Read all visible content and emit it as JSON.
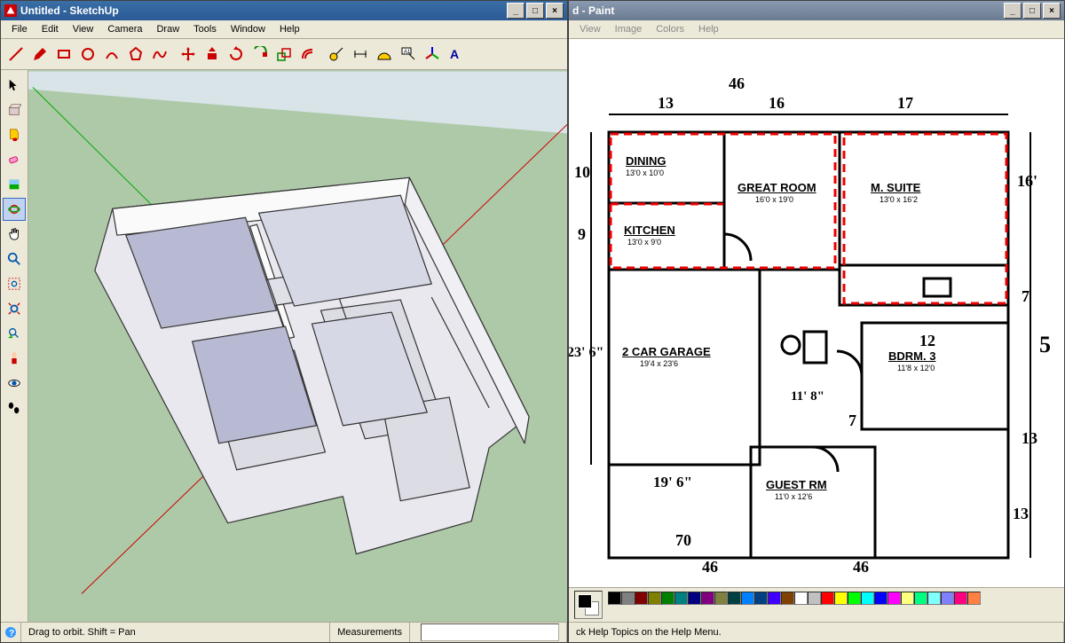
{
  "sketchup": {
    "title": "Untitled - SketchUp",
    "menus": [
      "File",
      "Edit",
      "View",
      "Camera",
      "Draw",
      "Tools",
      "Window",
      "Help"
    ],
    "status_hint": "Drag to orbit.  Shift = Pan",
    "measurements_label": "Measurements"
  },
  "paint": {
    "title": "d - Paint",
    "menus": [
      "View",
      "Image",
      "Colors",
      "Help"
    ],
    "status_hint": "ck Help Topics on the Help Menu.",
    "palette": [
      "#000000",
      "#808080",
      "#800000",
      "#808000",
      "#008000",
      "#008080",
      "#000080",
      "#800080",
      "#808040",
      "#004040",
      "#0080ff",
      "#004080",
      "#4000ff",
      "#804000",
      "#ffffff",
      "#c0c0c0",
      "#ff0000",
      "#ffff00",
      "#00ff00",
      "#00ffff",
      "#0000ff",
      "#ff00ff",
      "#ffff80",
      "#00ff80",
      "#80ffff",
      "#8080ff",
      "#ff0080",
      "#ff8040"
    ]
  },
  "floorplan": {
    "rooms": {
      "dining": {
        "name": "DINING",
        "dim": "13'0 x 10'0"
      },
      "great_room": {
        "name": "GREAT ROOM",
        "dim": "16'0 x 19'0"
      },
      "m_suite": {
        "name": "M. SUITE",
        "dim": "13'0 x 16'2"
      },
      "kitchen": {
        "name": "KITCHEN",
        "dim": "13'0 x 9'0"
      },
      "garage": {
        "name": "2 CAR GARAGE",
        "dim": "19'4 x 23'6"
      },
      "bdrm3": {
        "name": "BDRM. 3",
        "dim": "11'8 x 12'0"
      },
      "guest": {
        "name": "GUEST RM",
        "dim": "11'0 x 12'6"
      }
    },
    "annotations": {
      "top_a": "46",
      "top_b": "13",
      "top_c": "16",
      "top_d": "17",
      "left_a": "10",
      "left_b": "9",
      "left_c": "23' 6\"",
      "right_a": "16'",
      "right_b": "7",
      "right_c": "5",
      "right_d": "13",
      "right_e": "13",
      "mid_a": "11' 8\"",
      "mid_b": "12",
      "mid_c": "7",
      "bot_a": "19' 6\"",
      "bot_b": "70",
      "bot_c": "46",
      "bot_d": "46"
    }
  }
}
